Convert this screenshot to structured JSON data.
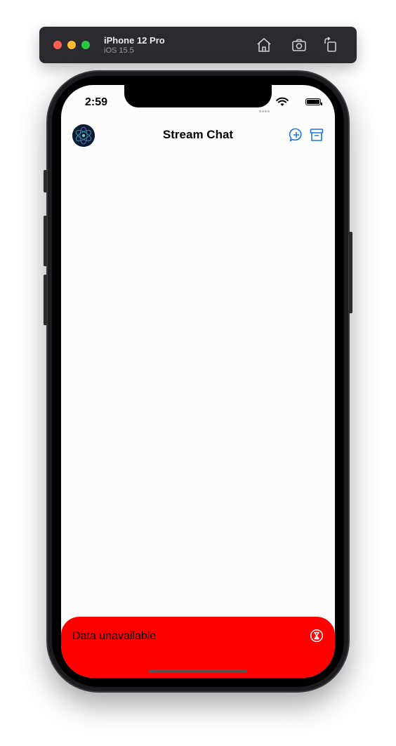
{
  "simulator": {
    "device_name": "iPhone 12 Pro",
    "os_version": "iOS 15.5",
    "buttons": [
      "home-icon",
      "screenshot-icon",
      "rotate-icon"
    ]
  },
  "status_bar": {
    "time": "2:59"
  },
  "nav_bar": {
    "title": "Stream Chat",
    "left": "avatar",
    "right_buttons": [
      "new-chat-icon",
      "archive-icon"
    ],
    "accent_color": "#1a73e8"
  },
  "banner": {
    "text": "Data unavailable",
    "icon": "hourglass-icon",
    "background": "#ff0000"
  }
}
